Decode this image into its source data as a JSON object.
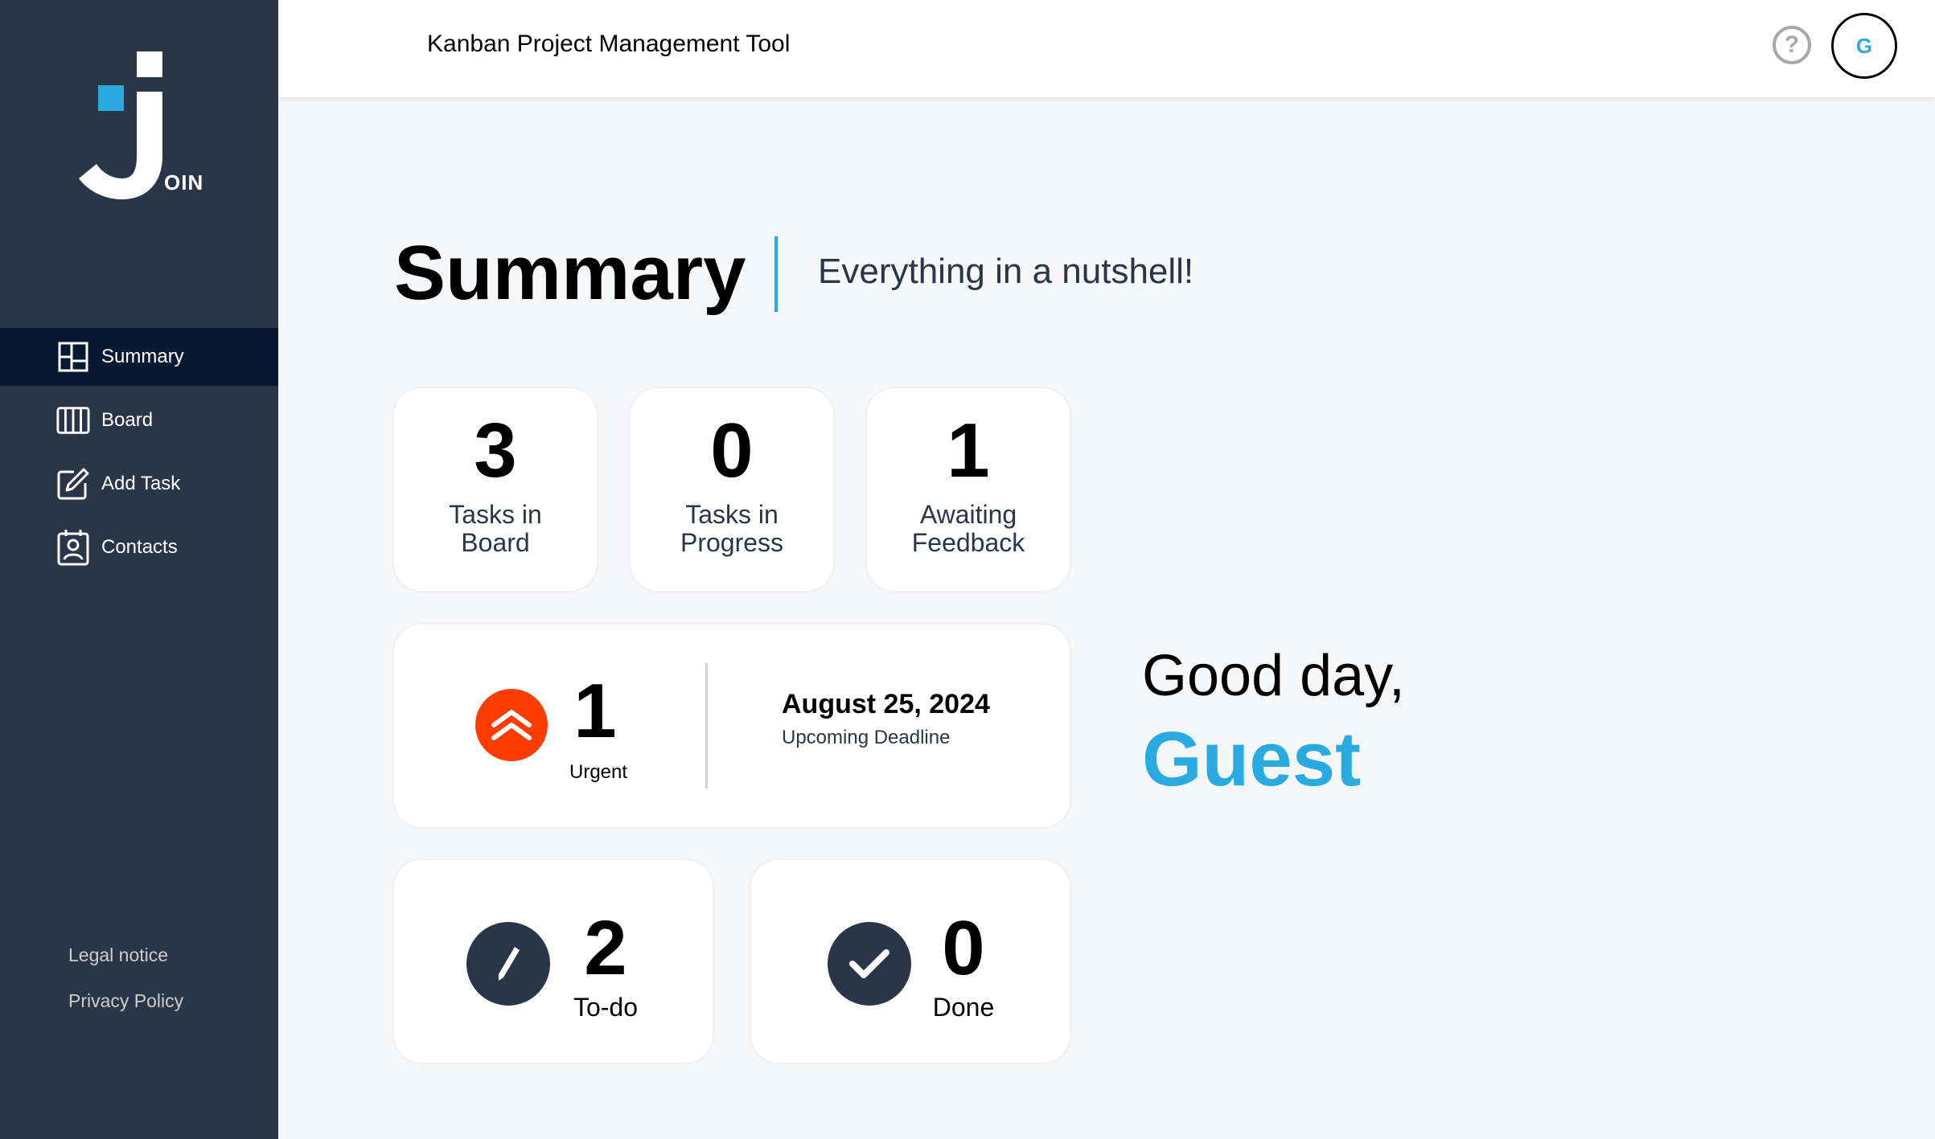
{
  "app": {
    "logo_text": "OIN",
    "title": "Kanban Project Management Tool",
    "user_initial": "G",
    "help_glyph": "?"
  },
  "sidebar": {
    "items": [
      {
        "label": "Summary",
        "icon": "summary-icon",
        "active": true
      },
      {
        "label": "Board",
        "icon": "board-icon",
        "active": false
      },
      {
        "label": "Add Task",
        "icon": "add-task-icon",
        "active": false
      },
      {
        "label": "Contacts",
        "icon": "contacts-icon",
        "active": false
      }
    ],
    "footer": [
      "Legal notice",
      "Privacy Policy"
    ]
  },
  "summary": {
    "title": "Summary",
    "subtitle": "Everything in a nutshell!",
    "stats": [
      {
        "value": "3",
        "label": "Tasks in Board"
      },
      {
        "value": "0",
        "label": "Tasks in Progress"
      },
      {
        "value": "1",
        "label": "Awaiting Feedback"
      }
    ],
    "urgent": {
      "value": "1",
      "label": "Urgent",
      "icon": "urgent-arrows-icon"
    },
    "deadline": {
      "date": "August 25, 2024",
      "label": "Upcoming Deadline"
    },
    "todo": {
      "value": "2",
      "label": "To-do",
      "icon": "pencil-icon"
    },
    "done": {
      "value": "0",
      "label": "Done",
      "icon": "check-icon"
    }
  },
  "greeting": {
    "text": "Good day,",
    "name": "Guest"
  },
  "colors": {
    "sidebar": "#2a3647",
    "active_nav": "#091931",
    "accent": "#29abe2",
    "urgent": "#ff3d00"
  }
}
